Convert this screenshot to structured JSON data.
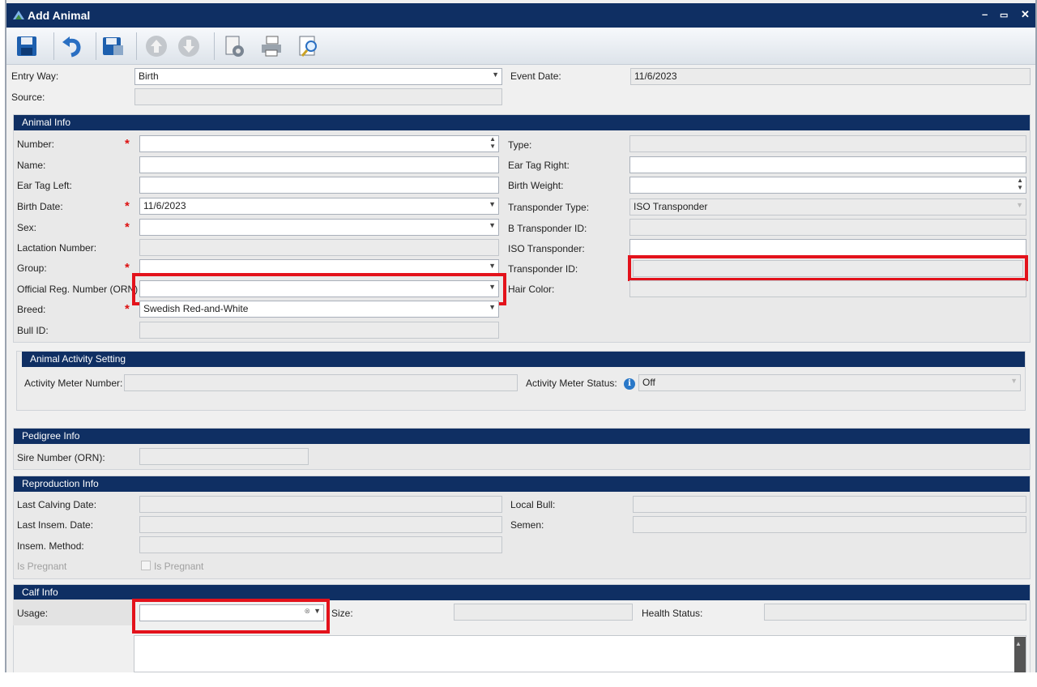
{
  "window": {
    "title": "Add Animal",
    "min": "–",
    "max": "▭",
    "close": "✕"
  },
  "toolbar": {
    "buttons": [
      "save-icon",
      "undo-icon",
      "save-close-icon",
      "up-arrow-icon",
      "down-arrow-icon",
      "settings-icon",
      "print-icon",
      "preview-icon"
    ]
  },
  "top": {
    "entry_way_label": "Entry Way:",
    "entry_way_value": "Birth",
    "source_label": "Source:",
    "event_date_label": "Event Date:",
    "event_date_value": "11/6/2023"
  },
  "animal_info": {
    "header": "Animal Info",
    "number_label": "Number:",
    "name_label": "Name:",
    "ear_tag_left_label": "Ear Tag Left:",
    "birth_date_label": "Birth Date:",
    "birth_date_value": "11/6/2023",
    "sex_label": "Sex:",
    "lactation_label": "Lactation Number:",
    "group_label": "Group:",
    "orn_label": "Official Reg. Number (ORN)",
    "breed_label": "Breed:",
    "breed_value": "Swedish Red-and-White",
    "bull_id_label": "Bull ID:",
    "type_label": "Type:",
    "ear_tag_right_label": "Ear Tag Right:",
    "birth_weight_label": "Birth Weight:",
    "transponder_type_label": "Transponder Type:",
    "transponder_type_value": "ISO Transponder",
    "b_transponder_label": "B Transponder ID:",
    "iso_transponder_label": "ISO Transponder:",
    "transponder_id_label": "Transponder ID:",
    "hair_color_label": "Hair Color:"
  },
  "activity": {
    "header": "Animal Activity Setting",
    "meter_number_label": "Activity Meter Number:",
    "meter_status_label": "Activity Meter Status:",
    "meter_status_value": "Off",
    "info_glyph": "i"
  },
  "pedigree": {
    "header": "Pedigree Info",
    "sire_label": "Sire Number (ORN):"
  },
  "reproduction": {
    "header": "Reproduction Info",
    "last_calving_label": "Last Calving Date:",
    "last_insem_label": "Last Insem. Date:",
    "insem_method_label": "Insem. Method:",
    "is_pregnant_label": "Is Pregnant",
    "is_pregnant_cb_label": "Is Pregnant",
    "local_bull_label": "Local Bull:",
    "semen_label": "Semen:"
  },
  "calf": {
    "header": "Calf Info",
    "usage_label": "Usage:",
    "size_label": "Size:",
    "health_label": "Health Status:"
  },
  "colors": {
    "header": "#0f2f63",
    "highlight": "#e3121b",
    "required": "#d11111"
  }
}
